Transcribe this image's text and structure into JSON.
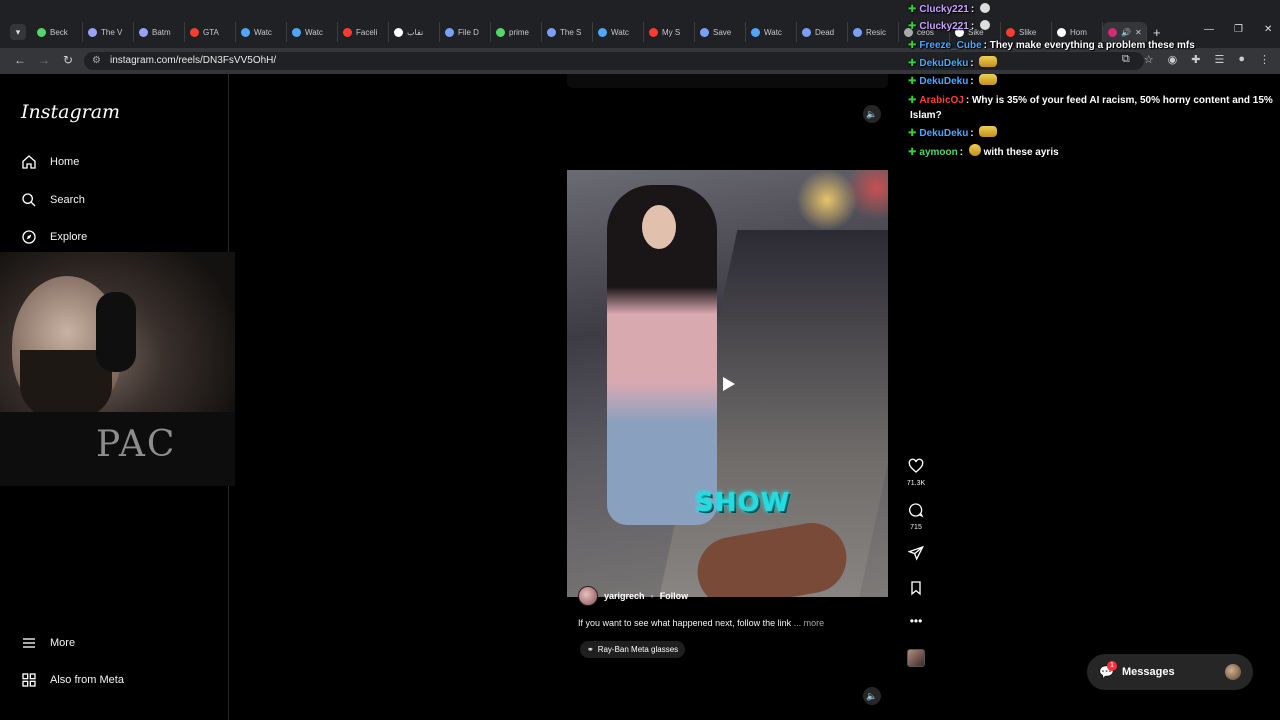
{
  "browser": {
    "tabs": [
      {
        "label": "Beck",
        "color": "#53d769"
      },
      {
        "label": "The V",
        "color": "#9aa0ff"
      },
      {
        "label": "Batm",
        "color": "#9aa0ff"
      },
      {
        "label": "GTA",
        "color": "#ff3b30"
      },
      {
        "label": "Watc",
        "color": "#4ea6ff"
      },
      {
        "label": "Watc",
        "color": "#4ea6ff"
      },
      {
        "label": "Faceli",
        "color": "#ff3b30"
      },
      {
        "label": "نقاب",
        "color": "#ffffff"
      },
      {
        "label": "File D",
        "color": "#7aa0ff"
      },
      {
        "label": "prime",
        "color": "#53d769"
      },
      {
        "label": "The S",
        "color": "#7aa0ff"
      },
      {
        "label": "Watc",
        "color": "#4ea6ff"
      },
      {
        "label": "My S",
        "color": "#ff3b30"
      },
      {
        "label": "Save",
        "color": "#7aa0ff"
      },
      {
        "label": "Watc",
        "color": "#4ea6ff"
      },
      {
        "label": "Dead",
        "color": "#7aa0ff"
      },
      {
        "label": "Resic",
        "color": "#7aa0ff"
      },
      {
        "label": "ceos",
        "color": "#aaaaaa"
      },
      {
        "label": "Sike",
        "color": "#ffffff"
      },
      {
        "label": "Slike",
        "color": "#ff3b30"
      },
      {
        "label": "Hom",
        "color": "#ffffff"
      }
    ],
    "url": "instagram.com/reels/DN3FsVV5OhH/"
  },
  "sidebar": {
    "logo": "Instagram",
    "items": [
      {
        "label": "Home"
      },
      {
        "label": "Search"
      },
      {
        "label": "Explore"
      }
    ],
    "bottom": [
      {
        "label": "More"
      },
      {
        "label": "Also from Meta"
      }
    ]
  },
  "webcam": {
    "shirt_text": "PAC"
  },
  "reel": {
    "username": "yarigrech",
    "follow_label": "Follow",
    "separator": "•",
    "caption": "If you want to see what happened next, follow the link",
    "more": "... more",
    "music": "Ray-Ban Meta glasses",
    "overlay_text": "SHOW",
    "likes": "71.3K",
    "comments": "715"
  },
  "chat": [
    {
      "name": "Clucky221",
      "color": "#c9a0ff",
      "text": "",
      "emote": "small"
    },
    {
      "name": "Clucky221",
      "color": "#c9a0ff",
      "text": "",
      "emote": "small"
    },
    {
      "name": "Freeze_Cube",
      "color": "#4ea6ff",
      "text": "They make everything a problem these mfs",
      "emote": "none"
    },
    {
      "name": "DekuDeku",
      "color": "#4ea6ff",
      "text": "",
      "emote": "wide"
    },
    {
      "name": "DekuDeku",
      "color": "#4ea6ff",
      "text": "",
      "emote": "wide"
    },
    {
      "name": "ArabicOJ",
      "color": "#ff4040",
      "text": "Why is 35% of your feed AI racism, 50% horny content and 15%",
      "emote": "none"
    },
    {
      "name": "",
      "color": "#ffffff",
      "text": "Islam?",
      "emote": "none"
    },
    {
      "name": "DekuDeku",
      "color": "#4ea6ff",
      "text": "",
      "emote": "wide"
    },
    {
      "name": "aymoon",
      "color": "#53d769",
      "text": "with these ayris",
      "emote": "round"
    }
  ],
  "messages": {
    "label": "Messages",
    "badge": "1"
  }
}
